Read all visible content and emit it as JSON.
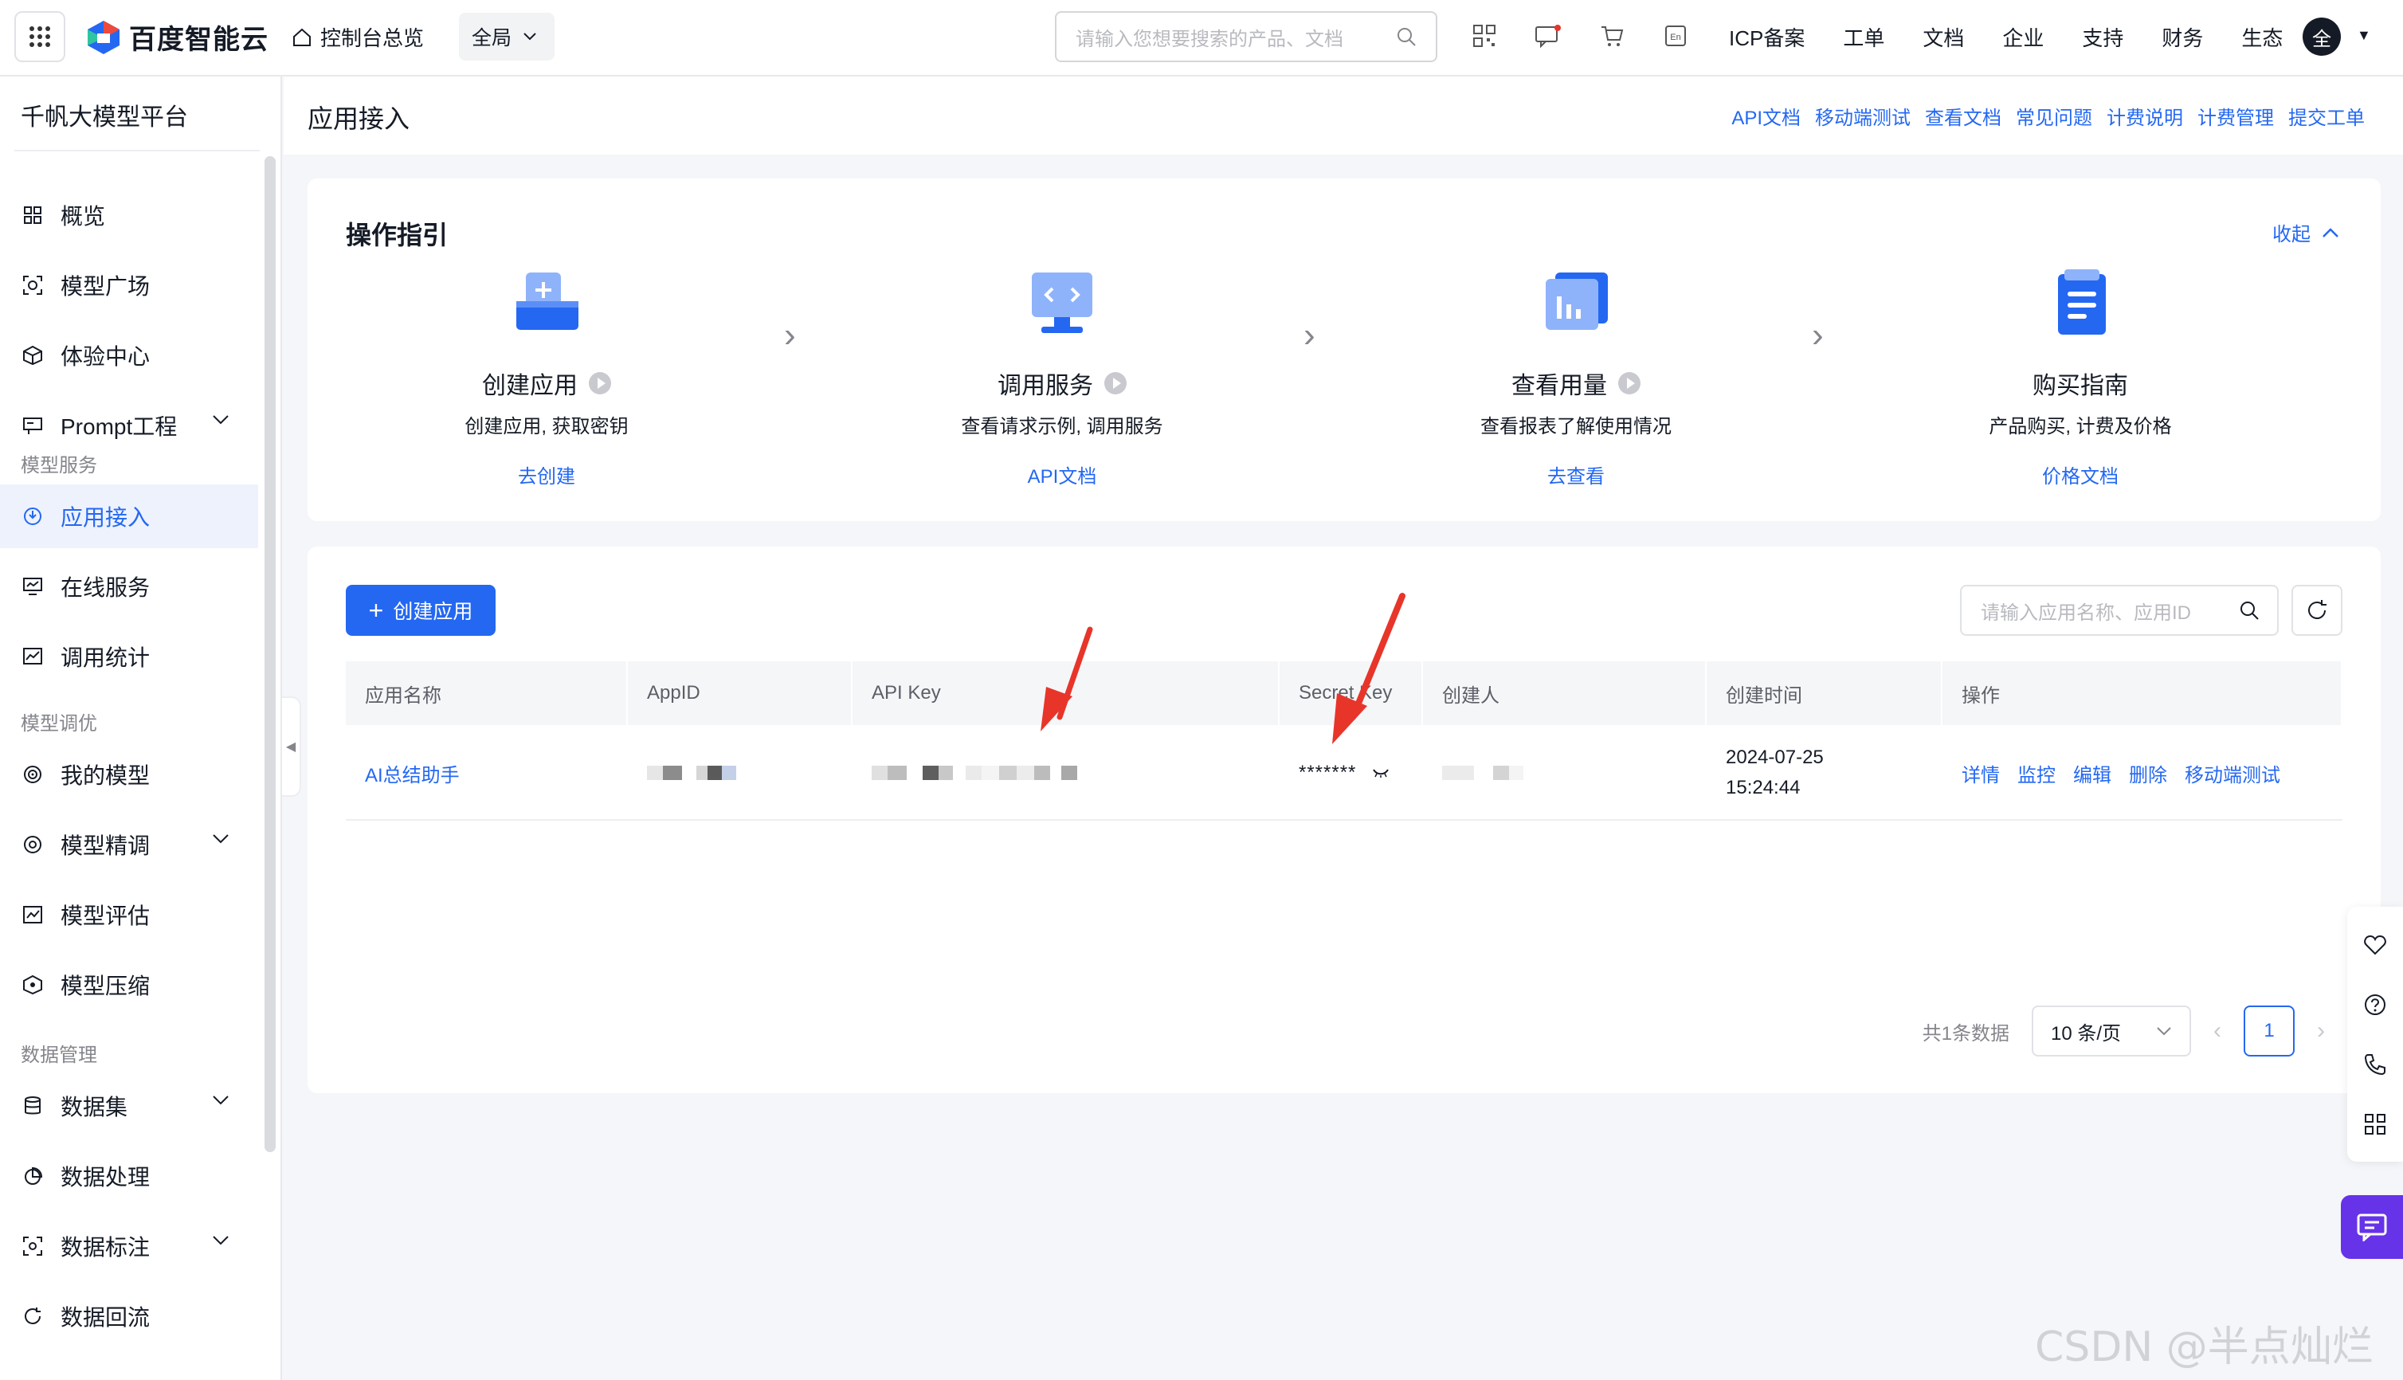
{
  "topbar": {
    "logo_text": "百度智能云",
    "console_home": "控制台总览",
    "scope": "全局",
    "search_placeholder": "请输入您想要搜索的产品、文档",
    "links": [
      "ICP备案",
      "工单",
      "文档",
      "企业",
      "支持",
      "财务",
      "生态"
    ],
    "avatar_text": "全"
  },
  "sidebar": {
    "platform_title": "千帆大模型平台",
    "items": [
      {
        "label": "概览"
      },
      {
        "label": "模型广场"
      },
      {
        "label": "体验中心"
      },
      {
        "label": "Prompt工程"
      },
      {
        "label": "应用接入"
      },
      {
        "label": "在线服务"
      },
      {
        "label": "调用统计"
      },
      {
        "label": "我的模型"
      },
      {
        "label": "模型精调"
      },
      {
        "label": "模型评估"
      },
      {
        "label": "模型压缩"
      },
      {
        "label": "数据集"
      },
      {
        "label": "数据处理"
      },
      {
        "label": "数据标注"
      },
      {
        "label": "数据回流"
      }
    ],
    "groups": [
      "模型服务",
      "模型调优",
      "数据管理"
    ]
  },
  "page": {
    "title": "应用接入",
    "header_links": [
      "API文档",
      "移动端测试",
      "查看文档",
      "常见问题",
      "计费说明",
      "计费管理",
      "提交工单"
    ]
  },
  "guide": {
    "title": "操作指引",
    "collapse_label": "收起",
    "steps": [
      {
        "name": "创建应用",
        "desc": "创建应用, 获取密钥",
        "link": "去创建"
      },
      {
        "name": "调用服务",
        "desc": "查看请求示例, 调用服务",
        "link": "API文档"
      },
      {
        "name": "查看用量",
        "desc": "查看报表了解使用情况",
        "link": "去查看"
      },
      {
        "name": "购买指南",
        "desc": "产品购买, 计费及价格",
        "link": "价格文档"
      }
    ]
  },
  "apps_table": {
    "create_label": "创建应用",
    "search_placeholder": "请输入应用名称、应用ID",
    "columns": [
      "应用名称",
      "AppID",
      "API Key",
      "Secret Key",
      "创建人",
      "创建时间",
      "操作"
    ],
    "rows": [
      {
        "name": "AI总结助手",
        "secret_key": "*******",
        "created_date": "2024-07-25",
        "created_time": "15:24:44",
        "actions": [
          "详情",
          "监控",
          "编辑",
          "删除",
          "移动端测试"
        ]
      }
    ],
    "total_label": "共1条数据",
    "page_size": "10 条/页",
    "current_page": "1"
  },
  "watermark": "CSDN @半点灿烂",
  "colors": {
    "accent": "#2468f2",
    "annotation": "#e8352a",
    "chat": "#6633e8"
  }
}
